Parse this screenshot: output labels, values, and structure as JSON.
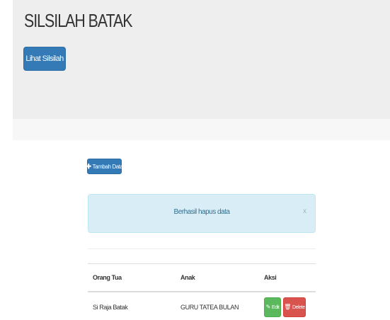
{
  "header": {
    "title": "SILSILAH BATAK",
    "view_button_label": "Lihat Silsilah"
  },
  "toolbar": {
    "add_button_label": "Tambah Data",
    "add_icon": "plus-icon"
  },
  "alert": {
    "message": "Berhasil hapus data",
    "close_label": "x"
  },
  "table": {
    "headers": [
      "Orang Tua",
      "Anak",
      "Aksi"
    ],
    "rows": [
      {
        "orang_tua": "Si Raja Batak",
        "anak": "GURU TATEA BULAN",
        "edit_label": "Edit",
        "delete_label": "Delete"
      }
    ]
  },
  "colors": {
    "primary": "#337ab7",
    "success": "#5cb85c",
    "danger": "#d9534f",
    "alert_info_bg": "#d9edf7",
    "jumbotron_bg": "#eeeeee"
  }
}
